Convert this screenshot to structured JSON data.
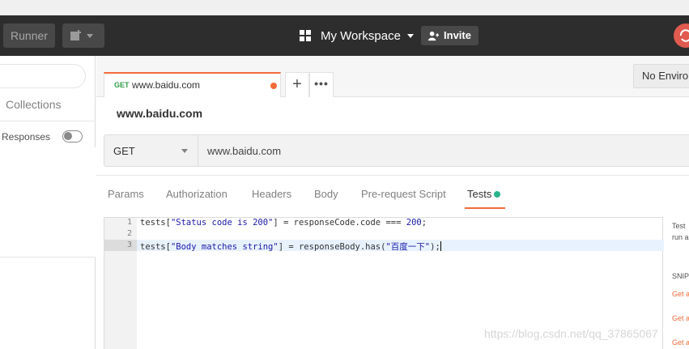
{
  "header": {
    "runner_label": "Runner",
    "workspace_label": "My Workspace",
    "invite_label": "Invite"
  },
  "sidebar": {
    "collections_label": "Collections",
    "save_responses_label": "ve Responses"
  },
  "tabs": {
    "active_method": "GET",
    "active_title": "www.baidu.com",
    "add_label": "+",
    "more_label": "•••"
  },
  "environment": {
    "selected": "No Environ"
  },
  "request": {
    "name": "www.baidu.com",
    "method": "GET",
    "url": "www.baidu.com"
  },
  "subtabs": [
    "Params",
    "Authorization",
    "Headers",
    "Body",
    "Pre-request Script",
    "Tests"
  ],
  "editor": {
    "line_numbers": [
      "1",
      "2",
      "3"
    ],
    "lines": [
      "tests[\"Status code is 200\"] = responseCode.code === 200;",
      "",
      "tests[\"Body matches string\"] = responseBody.has(\"百度一下\");"
    ]
  },
  "snippets": {
    "intro_1": "Test",
    "intro_2": "run a",
    "heading": "SNIP",
    "links": [
      "Get a",
      "Get a",
      "Get a"
    ]
  },
  "watermark": "https://blog.csdn.net/qq_37865067",
  "colors": {
    "accent": "#f26b3a",
    "header_bg": "#2d2d2d",
    "tests_dot": "#28b48c"
  }
}
